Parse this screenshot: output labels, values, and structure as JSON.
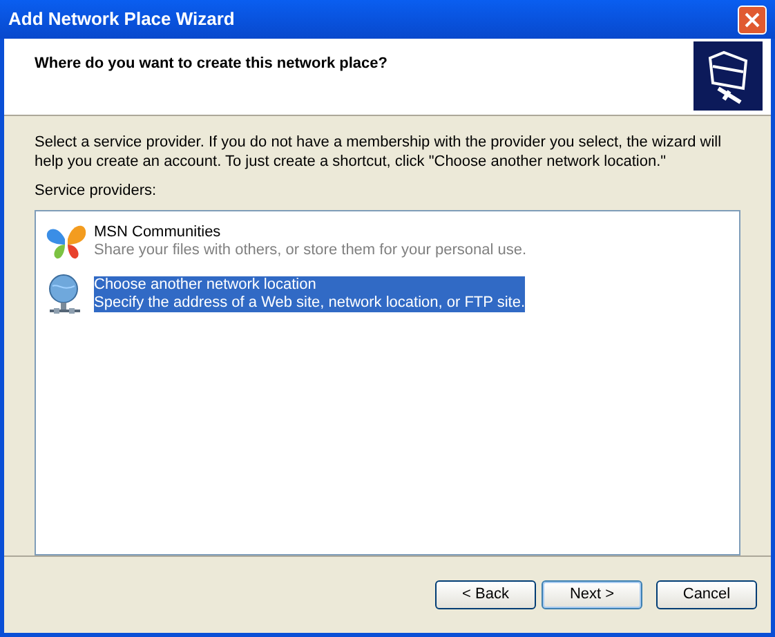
{
  "window": {
    "title": "Add Network Place Wizard"
  },
  "header": {
    "heading": "Where do you want to create this network place?"
  },
  "instructions": "Select a service provider.  If you do not have a membership with the provider you select, the wizard will help you create an account.  To just create a shortcut, click \"Choose another network location.\"",
  "list_label": "Service providers:",
  "providers": [
    {
      "kind": "butterfly",
      "name": "MSN Communities",
      "description": "Share your files with others, or store them for your personal use.",
      "selected": false
    },
    {
      "kind": "network",
      "name": "Choose another network location",
      "description": "Specify the address of a Web site, network location, or FTP site.",
      "selected": true
    }
  ],
  "buttons": [
    {
      "label": "< Back",
      "default": false
    },
    {
      "label": "Next >",
      "default": true
    },
    {
      "label": "Cancel",
      "default": false
    }
  ]
}
